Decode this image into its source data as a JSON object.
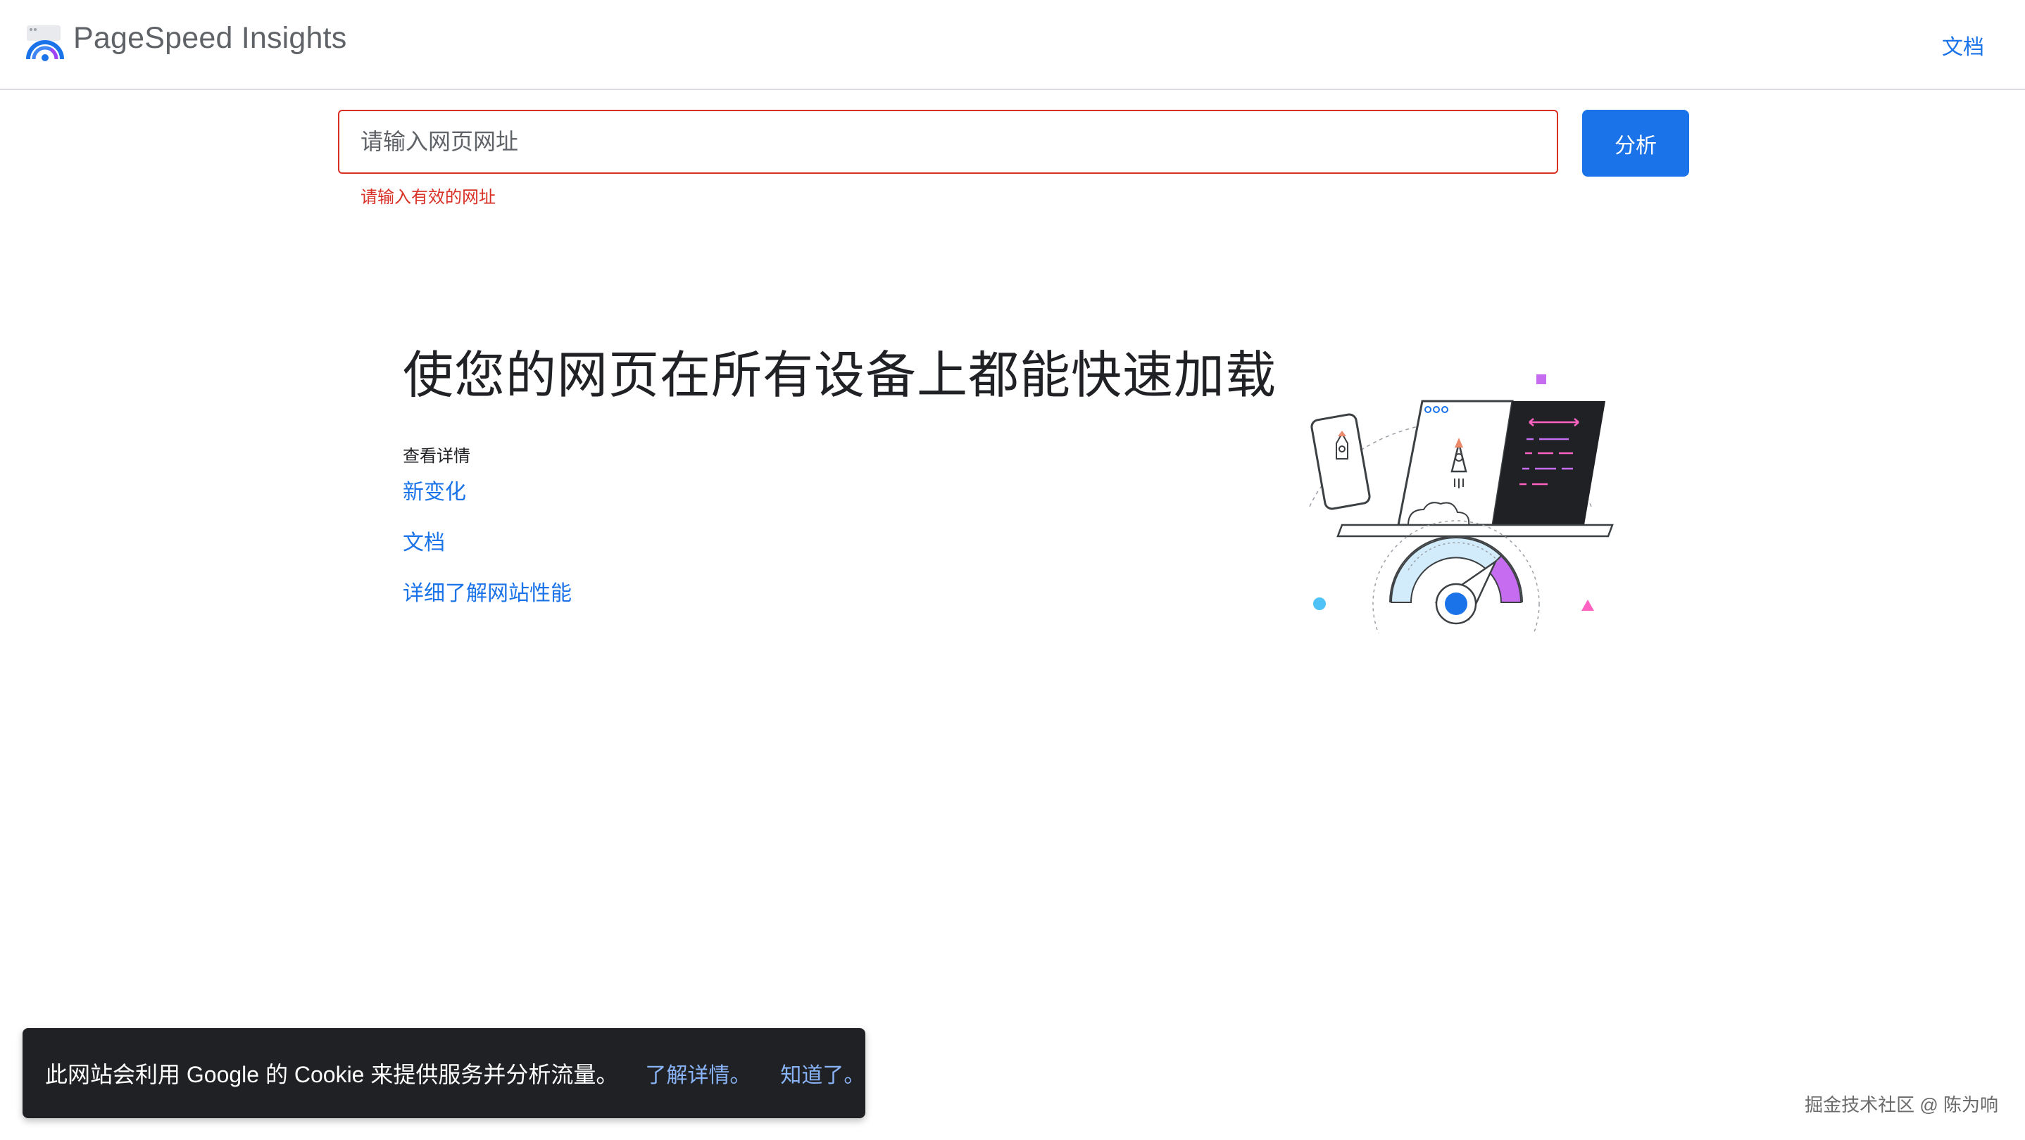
{
  "header": {
    "brand": "PageSpeed Insights",
    "docs_label": "文档"
  },
  "search": {
    "placeholder": "请输入网页网址",
    "value": "",
    "error": "请输入有效的网址",
    "analyze_label": "分析"
  },
  "hero": {
    "title": "使您的网页在所有设备上都能快速加载",
    "details_heading": "查看详情",
    "links": [
      "新变化",
      "文档",
      "详细了解网站性能"
    ]
  },
  "cookie": {
    "text": "此网站会利用 Google 的 Cookie 来提供服务并分析流量。",
    "learn_more": "了解详情。",
    "ok": "知道了。"
  },
  "watermark": "掘金技术社区 @ 陈为响",
  "colors": {
    "accent": "#1a73e8",
    "error": "#d93025",
    "cookie_bg": "#202124",
    "cookie_link": "#8ab4f8"
  }
}
